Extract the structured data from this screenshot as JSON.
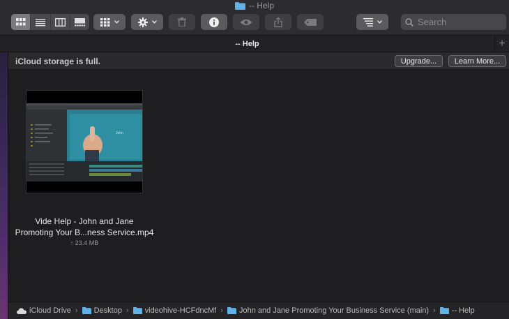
{
  "window": {
    "title": "-- Help"
  },
  "toolbar": {
    "view_buttons": [
      {
        "icon": "icon-view-icon",
        "active": true
      },
      {
        "icon": "list-view-icon",
        "active": false
      },
      {
        "icon": "column-view-icon",
        "active": false
      },
      {
        "icon": "gallery-view-icon",
        "active": false
      }
    ],
    "group_icon": "group-by-icon",
    "action_icon": "gear-icon",
    "trash_icon": "trash-icon",
    "info_icon": "info-icon",
    "quicklook_icon": "eye-icon",
    "share_icon": "share-icon",
    "tag_icon": "tag-icon",
    "sort_icon": "sort-icon",
    "search_placeholder": "Search"
  },
  "tabs": [
    {
      "label": "-- Help"
    }
  ],
  "banner": {
    "message": "iCloud storage is full.",
    "upgrade_label": "Upgrade...",
    "learn_more_label": "Learn More..."
  },
  "file": {
    "name_line1": "Vide Help - John and Jane",
    "name_line2": "Promoting Your B...ness Service.mp4",
    "size": "↑ 23.4 MB",
    "thumb_caption": "John"
  },
  "path": [
    {
      "label": "iCloud Drive",
      "icon": "cloud-icon"
    },
    {
      "label": "Desktop",
      "icon": "folder-icon"
    },
    {
      "label": "videohive-HCFdncMf",
      "icon": "folder-icon"
    },
    {
      "label": "John and Jane Promoting Your Business Service (main)",
      "icon": "folder-icon"
    },
    {
      "label": "-- Help",
      "icon": "folder-icon"
    }
  ],
  "colors": {
    "folder_blue": "#5fb3e8",
    "accent": "#3a8ad6"
  }
}
